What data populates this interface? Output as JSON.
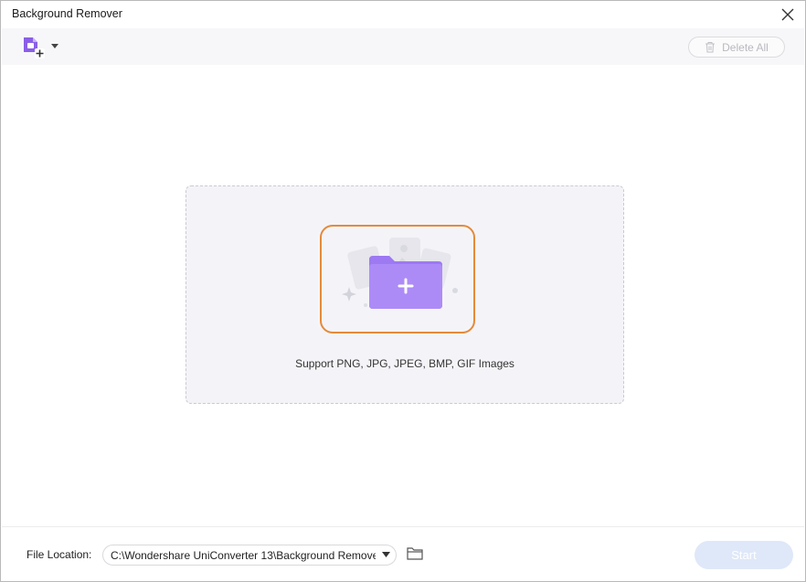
{
  "window": {
    "title": "Background Remover"
  },
  "toolbar": {
    "add_file_icon": "add-file-icon",
    "delete_all_label": "Delete All"
  },
  "drop_zone": {
    "icon": "add-folder-icon",
    "support_text": "Support PNG, JPG, JPEG, BMP, GIF Images"
  },
  "footer": {
    "file_location_label": "File Location:",
    "file_location_value": "C:\\Wondershare UniConverter 13\\Background Remove",
    "start_label": "Start"
  },
  "colors": {
    "accent_purple": "#9a6cf0",
    "highlight_orange": "#e58a3a",
    "start_disabled": "#dfe8f8"
  }
}
